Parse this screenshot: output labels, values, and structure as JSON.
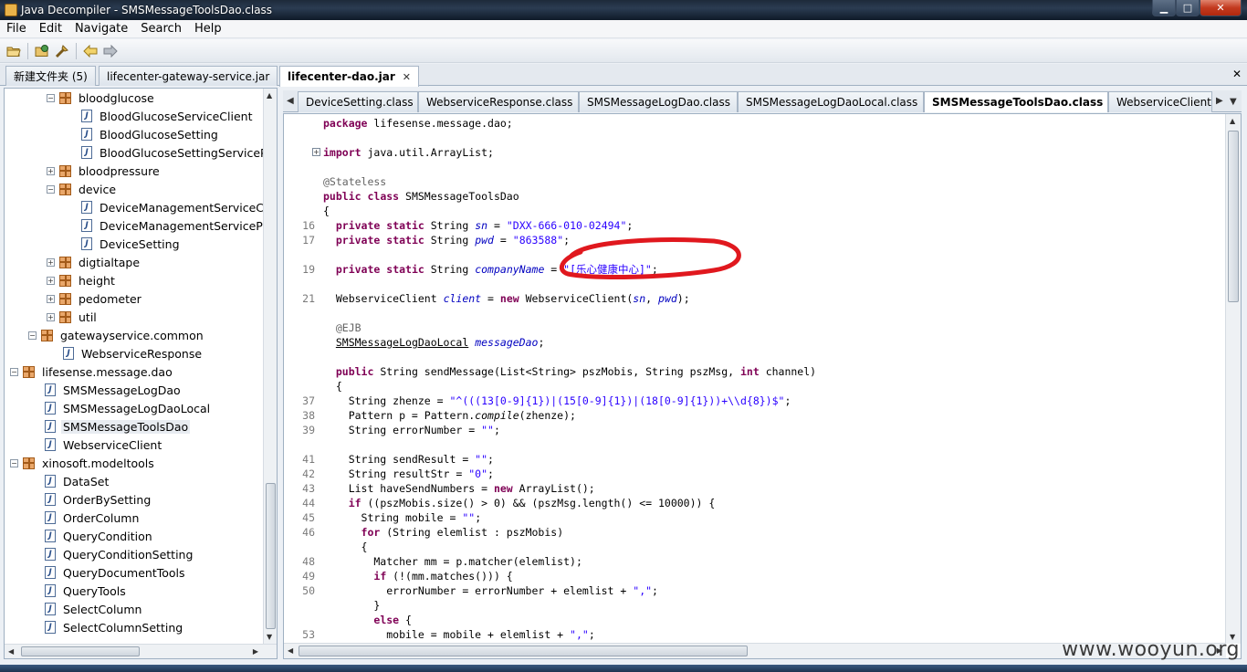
{
  "window": {
    "title": "Java Decompiler - SMSMessageToolsDao.class"
  },
  "menu": [
    "File",
    "Edit",
    "Navigate",
    "Search",
    "Help"
  ],
  "toolbar": {
    "icons": [
      "open-folder-icon",
      "open-type-icon",
      "search-icon",
      "back-arrow-icon",
      "forward-arrow-icon"
    ]
  },
  "jar_tabs": [
    {
      "label": "新建文件夹 (5)",
      "active": false
    },
    {
      "label": "lifecenter-gateway-service.jar",
      "active": false
    },
    {
      "label": "lifecenter-dao.jar",
      "active": true
    }
  ],
  "tree": [
    {
      "label": "bloodglucose",
      "type": "package",
      "expanded": true
    },
    {
      "label": "BloodGlucoseServiceClient",
      "type": "class"
    },
    {
      "label": "BloodGlucoseSetting",
      "type": "class"
    },
    {
      "label": "BloodGlucoseSettingServicePort",
      "type": "class"
    },
    {
      "label": "bloodpressure",
      "type": "package",
      "expanded": false
    },
    {
      "label": "device",
      "type": "package",
      "expanded": true
    },
    {
      "label": "DeviceManagementServiceClient",
      "type": "class"
    },
    {
      "label": "DeviceManagementServicePort",
      "type": "class"
    },
    {
      "label": "DeviceSetting",
      "type": "class"
    },
    {
      "label": "digtialtape",
      "type": "package",
      "expanded": false
    },
    {
      "label": "height",
      "type": "package",
      "expanded": false
    },
    {
      "label": "pedometer",
      "type": "package",
      "expanded": false
    },
    {
      "label": "util",
      "type": "package",
      "expanded": false
    },
    {
      "label": "gatewayservice.common",
      "type": "package",
      "expanded": true
    },
    {
      "label": "WebserviceResponse",
      "type": "class"
    },
    {
      "label": "lifesense.message.dao",
      "type": "package",
      "expanded": true
    },
    {
      "label": "SMSMessageLogDao",
      "type": "class"
    },
    {
      "label": "SMSMessageLogDaoLocal",
      "type": "class"
    },
    {
      "label": "SMSMessageToolsDao",
      "type": "class",
      "selected": true
    },
    {
      "label": "WebserviceClient",
      "type": "class"
    },
    {
      "label": "xinosoft.modeltools",
      "type": "package",
      "expanded": true
    },
    {
      "label": "DataSet",
      "type": "class"
    },
    {
      "label": "OrderBySetting",
      "type": "class"
    },
    {
      "label": "OrderColumn",
      "type": "class"
    },
    {
      "label": "QueryCondition",
      "type": "class"
    },
    {
      "label": "QueryConditionSetting",
      "type": "class"
    },
    {
      "label": "QueryDocumentTools",
      "type": "class"
    },
    {
      "label": "QueryTools",
      "type": "class"
    },
    {
      "label": "SelectColumn",
      "type": "class"
    },
    {
      "label": "SelectColumnSetting",
      "type": "class"
    }
  ],
  "editor_tabs": [
    {
      "label": "DeviceSetting.class",
      "active": false
    },
    {
      "label": "WebserviceResponse.class",
      "active": false
    },
    {
      "label": "SMSMessageLogDao.class",
      "active": false
    },
    {
      "label": "SMSMessageLogDaoLocal.class",
      "active": false
    },
    {
      "label": "SMSMessageToolsDao.class",
      "active": true
    },
    {
      "label": "WebserviceClient.c",
      "active": false
    }
  ],
  "code": [
    {
      "ln": "",
      "text": "package lifesense.message.dao;"
    },
    {
      "ln": "",
      "text": ""
    },
    {
      "ln": "",
      "text": "import java.util.ArrayList;",
      "fold": true
    },
    {
      "ln": "",
      "text": ""
    },
    {
      "ln": "",
      "text": "@Stateless"
    },
    {
      "ln": "",
      "text": "public class SMSMessageToolsDao"
    },
    {
      "ln": "",
      "text": "{"
    },
    {
      "ln": "16",
      "text": "  private static String sn = \"DXX-666-010-02494\";"
    },
    {
      "ln": "17",
      "text": "  private static String pwd = \"863588\";"
    },
    {
      "ln": "",
      "text": ""
    },
    {
      "ln": "19",
      "text": "  private static String companyName = \"[乐心健康中心]\";"
    },
    {
      "ln": "",
      "text": ""
    },
    {
      "ln": "21",
      "text": "  WebserviceClient client = new WebserviceClient(sn, pwd);"
    },
    {
      "ln": "",
      "text": ""
    },
    {
      "ln": "",
      "text": "  @EJB"
    },
    {
      "ln": "",
      "text": "  SMSMessageLogDaoLocal messageDao;"
    },
    {
      "ln": "",
      "text": ""
    },
    {
      "ln": "",
      "text": "  public String sendMessage(List<String> pszMobis, String pszMsg, int channel)"
    },
    {
      "ln": "",
      "text": "  {"
    },
    {
      "ln": "37",
      "text": "    String zhenze = \"^(((13[0-9]{1})|(15[0-9]{1})|(18[0-9]{1}))+\\\\d{8})$\";"
    },
    {
      "ln": "38",
      "text": "    Pattern p = Pattern.compile(zhenze);"
    },
    {
      "ln": "39",
      "text": "    String errorNumber = \"\";"
    },
    {
      "ln": "",
      "text": ""
    },
    {
      "ln": "41",
      "text": "    String sendResult = \"\";"
    },
    {
      "ln": "42",
      "text": "    String resultStr = \"0\";"
    },
    {
      "ln": "43",
      "text": "    List haveSendNumbers = new ArrayList();"
    },
    {
      "ln": "44",
      "text": "    if ((pszMobis.size() > 0) && (pszMsg.length() <= 10000)) {"
    },
    {
      "ln": "45",
      "text": "      String mobile = \"\";"
    },
    {
      "ln": "46",
      "text": "      for (String elemlist : pszMobis)"
    },
    {
      "ln": "",
      "text": "      {"
    },
    {
      "ln": "48",
      "text": "        Matcher mm = p.matcher(elemlist);"
    },
    {
      "ln": "49",
      "text": "        if (!(mm.matches())) {"
    },
    {
      "ln": "50",
      "text": "          errorNumber = errorNumber + elemlist + \",\";"
    },
    {
      "ln": "",
      "text": "        }"
    },
    {
      "ln": "",
      "text": "        else {"
    },
    {
      "ln": "53",
      "text": "          mobile = mobile + elemlist + \",\";"
    }
  ],
  "watermark": "www.wooyun.org"
}
